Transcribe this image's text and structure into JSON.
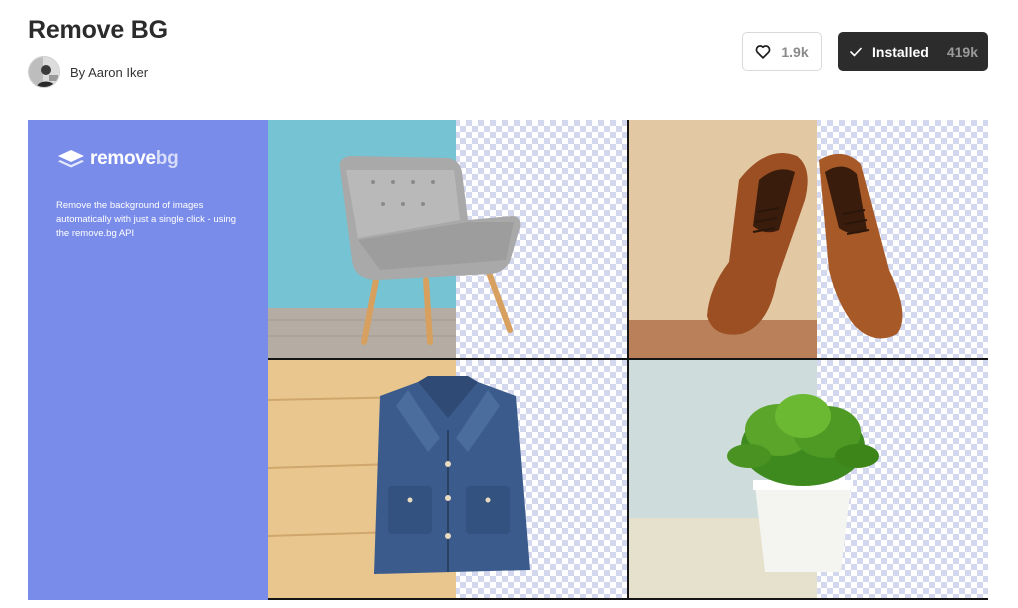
{
  "header": {
    "title": "Remove BG",
    "author": "By Aaron Iker"
  },
  "actions": {
    "like_count": "1.9k",
    "install_label": "Installed",
    "install_count": "419k"
  },
  "banner": {
    "brand_main": "remove",
    "brand_accent": "bg",
    "tagline": "Remove the background of images automatically with just a single click - using the remove.bg API",
    "panel_color": "#7a8ce9"
  },
  "icons": {
    "like": "heart-icon",
    "installed": "check-icon",
    "brand": "layers-logo-icon"
  },
  "colors": {
    "install_bg": "#2c2c2c",
    "checker": "#d4d8ee"
  }
}
